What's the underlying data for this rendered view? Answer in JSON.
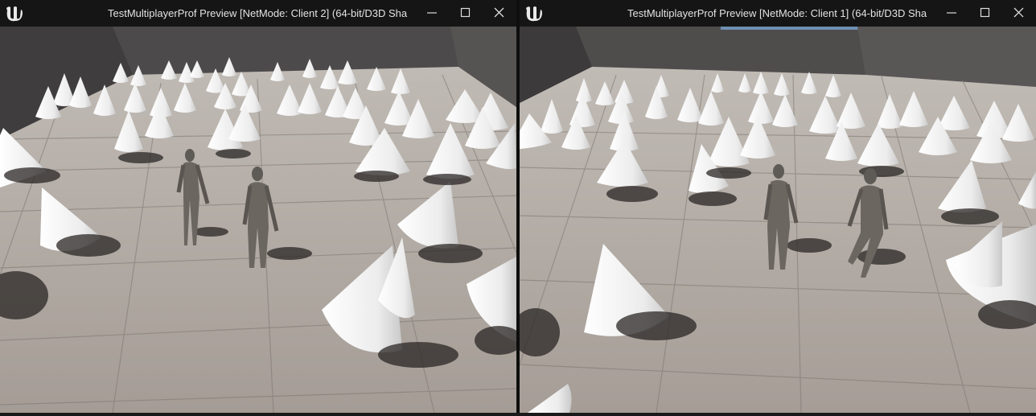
{
  "windows": [
    {
      "title": "TestMultiplayerProf Preview [NetMode: Client 2]  (64-bit/D3D Sha",
      "logo": "unreal-logo-icon",
      "controls": [
        "minimize-icon",
        "maximize-icon",
        "close-icon"
      ]
    },
    {
      "title": "TestMultiplayerProf Preview [NetMode: Client 1]  (64-bit/D3D Sha",
      "logo": "unreal-logo-icon",
      "controls": [
        "minimize-icon",
        "maximize-icon",
        "close-icon"
      ]
    }
  ],
  "colors": {
    "titlebar": "#151515",
    "title_text": "#e2e2e2",
    "floor": "#a9a29c",
    "wall": "#5a5757",
    "cone": "#efefef",
    "character": "#6b6660"
  }
}
